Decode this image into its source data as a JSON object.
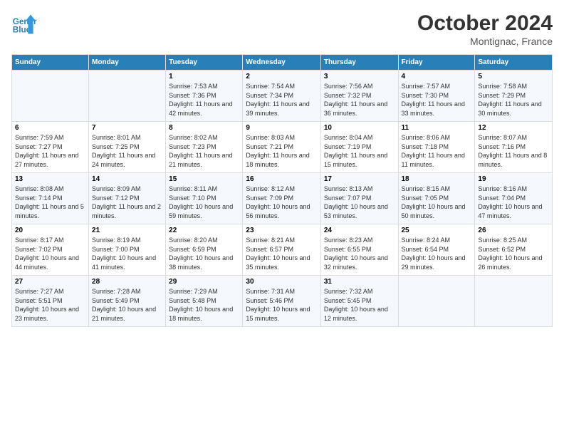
{
  "header": {
    "logo_line1": "General",
    "logo_line2": "Blue",
    "month": "October 2024",
    "location": "Montignac, France"
  },
  "columns": [
    "Sunday",
    "Monday",
    "Tuesday",
    "Wednesday",
    "Thursday",
    "Friday",
    "Saturday"
  ],
  "weeks": [
    [
      {
        "num": "",
        "info": ""
      },
      {
        "num": "",
        "info": ""
      },
      {
        "num": "1",
        "info": "Sunrise: 7:53 AM\nSunset: 7:36 PM\nDaylight: 11 hours and 42 minutes."
      },
      {
        "num": "2",
        "info": "Sunrise: 7:54 AM\nSunset: 7:34 PM\nDaylight: 11 hours and 39 minutes."
      },
      {
        "num": "3",
        "info": "Sunrise: 7:56 AM\nSunset: 7:32 PM\nDaylight: 11 hours and 36 minutes."
      },
      {
        "num": "4",
        "info": "Sunrise: 7:57 AM\nSunset: 7:30 PM\nDaylight: 11 hours and 33 minutes."
      },
      {
        "num": "5",
        "info": "Sunrise: 7:58 AM\nSunset: 7:29 PM\nDaylight: 11 hours and 30 minutes."
      }
    ],
    [
      {
        "num": "6",
        "info": "Sunrise: 7:59 AM\nSunset: 7:27 PM\nDaylight: 11 hours and 27 minutes."
      },
      {
        "num": "7",
        "info": "Sunrise: 8:01 AM\nSunset: 7:25 PM\nDaylight: 11 hours and 24 minutes."
      },
      {
        "num": "8",
        "info": "Sunrise: 8:02 AM\nSunset: 7:23 PM\nDaylight: 11 hours and 21 minutes."
      },
      {
        "num": "9",
        "info": "Sunrise: 8:03 AM\nSunset: 7:21 PM\nDaylight: 11 hours and 18 minutes."
      },
      {
        "num": "10",
        "info": "Sunrise: 8:04 AM\nSunset: 7:19 PM\nDaylight: 11 hours and 15 minutes."
      },
      {
        "num": "11",
        "info": "Sunrise: 8:06 AM\nSunset: 7:18 PM\nDaylight: 11 hours and 11 minutes."
      },
      {
        "num": "12",
        "info": "Sunrise: 8:07 AM\nSunset: 7:16 PM\nDaylight: 11 hours and 8 minutes."
      }
    ],
    [
      {
        "num": "13",
        "info": "Sunrise: 8:08 AM\nSunset: 7:14 PM\nDaylight: 11 hours and 5 minutes."
      },
      {
        "num": "14",
        "info": "Sunrise: 8:09 AM\nSunset: 7:12 PM\nDaylight: 11 hours and 2 minutes."
      },
      {
        "num": "15",
        "info": "Sunrise: 8:11 AM\nSunset: 7:10 PM\nDaylight: 10 hours and 59 minutes."
      },
      {
        "num": "16",
        "info": "Sunrise: 8:12 AM\nSunset: 7:09 PM\nDaylight: 10 hours and 56 minutes."
      },
      {
        "num": "17",
        "info": "Sunrise: 8:13 AM\nSunset: 7:07 PM\nDaylight: 10 hours and 53 minutes."
      },
      {
        "num": "18",
        "info": "Sunrise: 8:15 AM\nSunset: 7:05 PM\nDaylight: 10 hours and 50 minutes."
      },
      {
        "num": "19",
        "info": "Sunrise: 8:16 AM\nSunset: 7:04 PM\nDaylight: 10 hours and 47 minutes."
      }
    ],
    [
      {
        "num": "20",
        "info": "Sunrise: 8:17 AM\nSunset: 7:02 PM\nDaylight: 10 hours and 44 minutes."
      },
      {
        "num": "21",
        "info": "Sunrise: 8:19 AM\nSunset: 7:00 PM\nDaylight: 10 hours and 41 minutes."
      },
      {
        "num": "22",
        "info": "Sunrise: 8:20 AM\nSunset: 6:59 PM\nDaylight: 10 hours and 38 minutes."
      },
      {
        "num": "23",
        "info": "Sunrise: 8:21 AM\nSunset: 6:57 PM\nDaylight: 10 hours and 35 minutes."
      },
      {
        "num": "24",
        "info": "Sunrise: 8:23 AM\nSunset: 6:55 PM\nDaylight: 10 hours and 32 minutes."
      },
      {
        "num": "25",
        "info": "Sunrise: 8:24 AM\nSunset: 6:54 PM\nDaylight: 10 hours and 29 minutes."
      },
      {
        "num": "26",
        "info": "Sunrise: 8:25 AM\nSunset: 6:52 PM\nDaylight: 10 hours and 26 minutes."
      }
    ],
    [
      {
        "num": "27",
        "info": "Sunrise: 7:27 AM\nSunset: 5:51 PM\nDaylight: 10 hours and 23 minutes."
      },
      {
        "num": "28",
        "info": "Sunrise: 7:28 AM\nSunset: 5:49 PM\nDaylight: 10 hours and 21 minutes."
      },
      {
        "num": "29",
        "info": "Sunrise: 7:29 AM\nSunset: 5:48 PM\nDaylight: 10 hours and 18 minutes."
      },
      {
        "num": "30",
        "info": "Sunrise: 7:31 AM\nSunset: 5:46 PM\nDaylight: 10 hours and 15 minutes."
      },
      {
        "num": "31",
        "info": "Sunrise: 7:32 AM\nSunset: 5:45 PM\nDaylight: 10 hours and 12 minutes."
      },
      {
        "num": "",
        "info": ""
      },
      {
        "num": "",
        "info": ""
      }
    ]
  ]
}
